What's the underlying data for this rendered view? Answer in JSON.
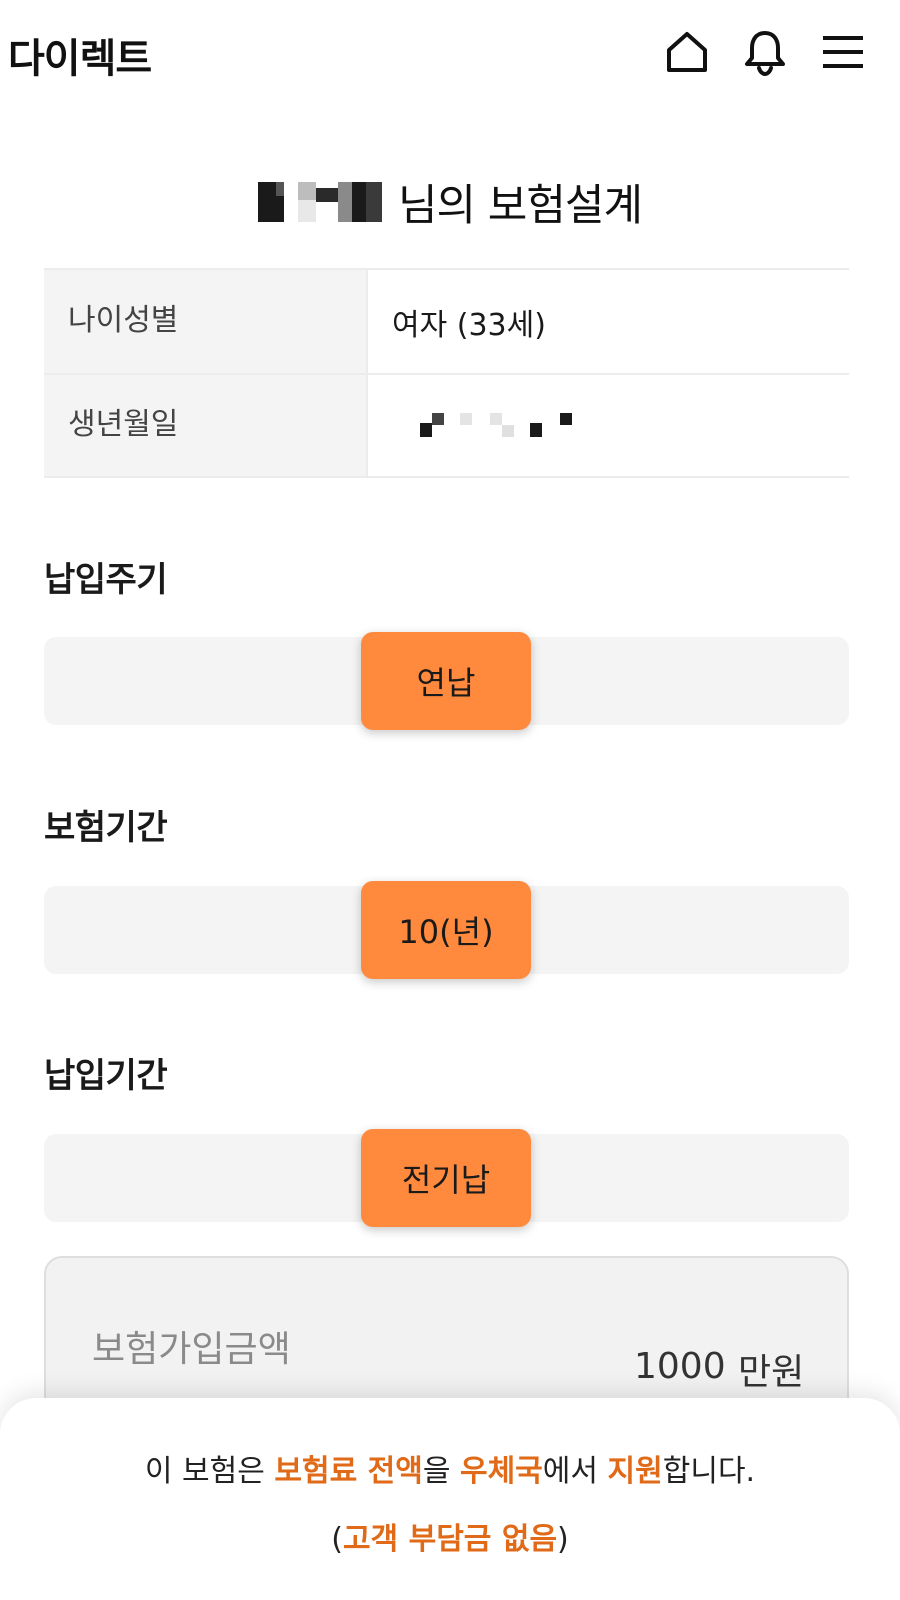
{
  "header": {
    "brand": "다이렉트",
    "icons": [
      "home-icon",
      "bell-icon",
      "menu-icon"
    ]
  },
  "title": {
    "suffix": "님의 보험설계"
  },
  "info_table": {
    "rows": [
      {
        "label": "나이성별",
        "value": "여자 (33세)"
      },
      {
        "label": "생년월일",
        "value": ""
      }
    ]
  },
  "sections": [
    {
      "label": "납입주기",
      "selected": "연납"
    },
    {
      "label": "보험기간",
      "selected": "10(년)"
    },
    {
      "label": "납입기간",
      "selected": "전기납"
    }
  ],
  "amount": {
    "label": "보험가입금액",
    "value": "1000",
    "unit": "만원"
  },
  "notice": {
    "line1": {
      "p1": "이 보험은 ",
      "h1": "보험료 전액",
      "p2": "을 ",
      "h2": "우체국",
      "p3": "에서 ",
      "h3": "지원",
      "p4": "합니다."
    },
    "line2": {
      "open": "(",
      "h1": "고객 부담금 없음",
      "close": ")"
    }
  },
  "colors": {
    "accent": "#ff8a3d",
    "highlight_text": "#e06a17",
    "track_bg": "#f4f4f4"
  }
}
